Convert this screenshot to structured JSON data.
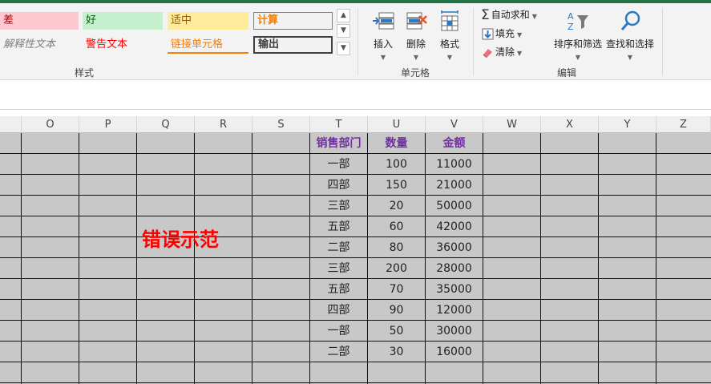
{
  "ribbon": {
    "styles": {
      "bad": "差",
      "good": "好",
      "neutral": "适中",
      "calculation": "计算",
      "explanatory": "解释性文本",
      "warning": "警告文本",
      "linked_cell": "链接单元格",
      "output": "输出",
      "group_label": "样式"
    },
    "cells": {
      "insert": "插入",
      "delete": "删除",
      "format": "格式",
      "group_label": "单元格"
    },
    "editing": {
      "autosum": "自动求和",
      "fill": "填充",
      "clear": "清除",
      "sort_filter": "排序和筛选",
      "find_select": "查找和选择",
      "group_label": "编辑"
    },
    "colors": {
      "accent": "#217346",
      "header_text": "#7030a0",
      "error_text": "#ff0000",
      "grid_bg": "#c8c8c8"
    }
  },
  "grid": {
    "columns": [
      "O",
      "P",
      "Q",
      "R",
      "S",
      "T",
      "U",
      "V",
      "W",
      "X",
      "Y",
      "Z"
    ],
    "table_headers": [
      "销售部门",
      "数量",
      "金额"
    ],
    "rows": [
      [
        "一部",
        "100",
        "11000"
      ],
      [
        "四部",
        "150",
        "21000"
      ],
      [
        "三部",
        "20",
        "50000"
      ],
      [
        "五部",
        "60",
        "42000"
      ],
      [
        "二部",
        "80",
        "36000"
      ],
      [
        "三部",
        "200",
        "28000"
      ],
      [
        "五部",
        "70",
        "35000"
      ],
      [
        "四部",
        "90",
        "12000"
      ],
      [
        "一部",
        "50",
        "30000"
      ],
      [
        "二部",
        "30",
        "16000"
      ]
    ],
    "annotation": "错误示范"
  }
}
